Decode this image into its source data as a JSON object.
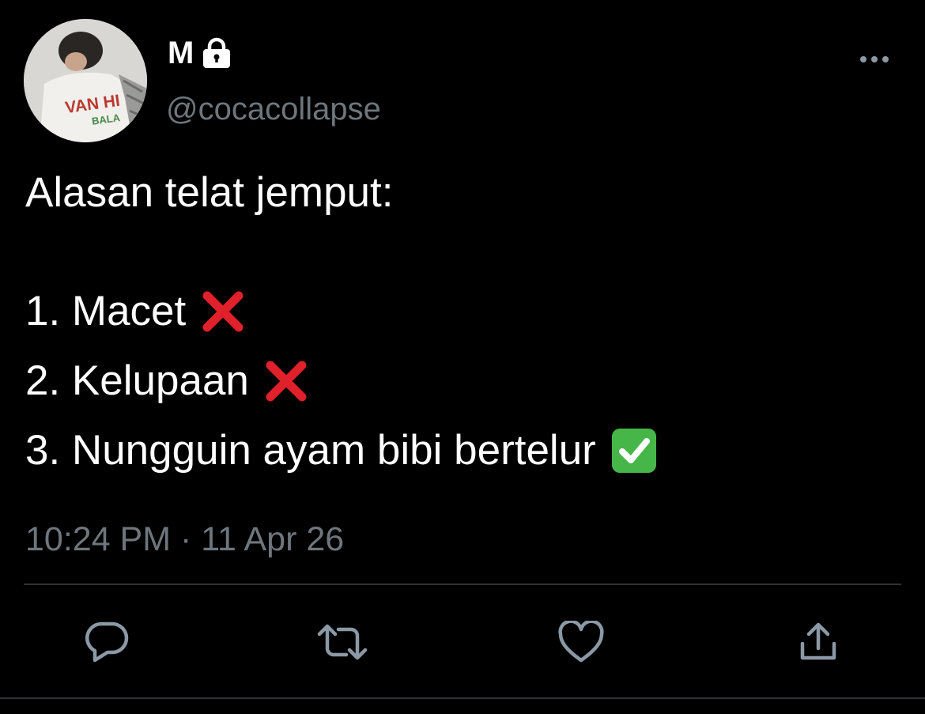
{
  "tweet": {
    "author": {
      "display_name": "M",
      "handle": "@cocacollapse",
      "avatar_shirt_text_1": "VAN HI",
      "avatar_shirt_text_2": "BALA"
    },
    "lines": {
      "intro": "Alasan telat jemput:",
      "item1": "1. Macet",
      "item2": "2. Kelupaan",
      "item3": "3. Nungguin ayam bibi bertelur"
    },
    "emojis": {
      "item1": "cross-mark-icon",
      "item2": "cross-mark-icon",
      "item3": "check-mark-button-icon"
    },
    "timestamp": "10:24 PM · 11 Apr 26"
  },
  "icons": {
    "lock": "lock-icon",
    "more": "more-dots-icon",
    "reply": "reply-icon",
    "retweet": "retweet-icon",
    "like": "heart-icon",
    "share": "share-icon"
  },
  "colors": {
    "background": "#000000",
    "text": "#ffffff",
    "secondary_text": "#6e767d",
    "divider": "#2f3336",
    "icon": "#8b98a5",
    "cross": "#e0202a",
    "check": "#46b649"
  }
}
